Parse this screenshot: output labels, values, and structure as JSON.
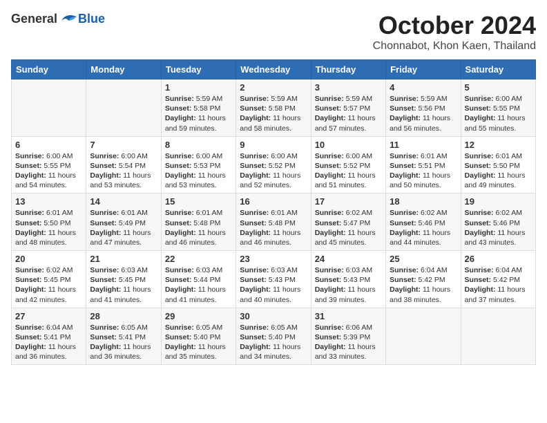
{
  "logo": {
    "general": "General",
    "blue": "Blue"
  },
  "title": "October 2024",
  "location": "Chonnabot, Khon Kaen, Thailand",
  "weekdays": [
    "Sunday",
    "Monday",
    "Tuesday",
    "Wednesday",
    "Thursday",
    "Friday",
    "Saturday"
  ],
  "weeks": [
    [
      {
        "day": "",
        "info": ""
      },
      {
        "day": "",
        "info": ""
      },
      {
        "day": "1",
        "info": "Sunrise: 5:59 AM\nSunset: 5:58 PM\nDaylight: 11 hours and 59 minutes."
      },
      {
        "day": "2",
        "info": "Sunrise: 5:59 AM\nSunset: 5:58 PM\nDaylight: 11 hours and 58 minutes."
      },
      {
        "day": "3",
        "info": "Sunrise: 5:59 AM\nSunset: 5:57 PM\nDaylight: 11 hours and 57 minutes."
      },
      {
        "day": "4",
        "info": "Sunrise: 5:59 AM\nSunset: 5:56 PM\nDaylight: 11 hours and 56 minutes."
      },
      {
        "day": "5",
        "info": "Sunrise: 6:00 AM\nSunset: 5:55 PM\nDaylight: 11 hours and 55 minutes."
      }
    ],
    [
      {
        "day": "6",
        "info": "Sunrise: 6:00 AM\nSunset: 5:55 PM\nDaylight: 11 hours and 54 minutes."
      },
      {
        "day": "7",
        "info": "Sunrise: 6:00 AM\nSunset: 5:54 PM\nDaylight: 11 hours and 53 minutes."
      },
      {
        "day": "8",
        "info": "Sunrise: 6:00 AM\nSunset: 5:53 PM\nDaylight: 11 hours and 53 minutes."
      },
      {
        "day": "9",
        "info": "Sunrise: 6:00 AM\nSunset: 5:52 PM\nDaylight: 11 hours and 52 minutes."
      },
      {
        "day": "10",
        "info": "Sunrise: 6:00 AM\nSunset: 5:52 PM\nDaylight: 11 hours and 51 minutes."
      },
      {
        "day": "11",
        "info": "Sunrise: 6:01 AM\nSunset: 5:51 PM\nDaylight: 11 hours and 50 minutes."
      },
      {
        "day": "12",
        "info": "Sunrise: 6:01 AM\nSunset: 5:50 PM\nDaylight: 11 hours and 49 minutes."
      }
    ],
    [
      {
        "day": "13",
        "info": "Sunrise: 6:01 AM\nSunset: 5:50 PM\nDaylight: 11 hours and 48 minutes."
      },
      {
        "day": "14",
        "info": "Sunrise: 6:01 AM\nSunset: 5:49 PM\nDaylight: 11 hours and 47 minutes."
      },
      {
        "day": "15",
        "info": "Sunrise: 6:01 AM\nSunset: 5:48 PM\nDaylight: 11 hours and 46 minutes."
      },
      {
        "day": "16",
        "info": "Sunrise: 6:01 AM\nSunset: 5:48 PM\nDaylight: 11 hours and 46 minutes."
      },
      {
        "day": "17",
        "info": "Sunrise: 6:02 AM\nSunset: 5:47 PM\nDaylight: 11 hours and 45 minutes."
      },
      {
        "day": "18",
        "info": "Sunrise: 6:02 AM\nSunset: 5:46 PM\nDaylight: 11 hours and 44 minutes."
      },
      {
        "day": "19",
        "info": "Sunrise: 6:02 AM\nSunset: 5:46 PM\nDaylight: 11 hours and 43 minutes."
      }
    ],
    [
      {
        "day": "20",
        "info": "Sunrise: 6:02 AM\nSunset: 5:45 PM\nDaylight: 11 hours and 42 minutes."
      },
      {
        "day": "21",
        "info": "Sunrise: 6:03 AM\nSunset: 5:45 PM\nDaylight: 11 hours and 41 minutes."
      },
      {
        "day": "22",
        "info": "Sunrise: 6:03 AM\nSunset: 5:44 PM\nDaylight: 11 hours and 41 minutes."
      },
      {
        "day": "23",
        "info": "Sunrise: 6:03 AM\nSunset: 5:43 PM\nDaylight: 11 hours and 40 minutes."
      },
      {
        "day": "24",
        "info": "Sunrise: 6:03 AM\nSunset: 5:43 PM\nDaylight: 11 hours and 39 minutes."
      },
      {
        "day": "25",
        "info": "Sunrise: 6:04 AM\nSunset: 5:42 PM\nDaylight: 11 hours and 38 minutes."
      },
      {
        "day": "26",
        "info": "Sunrise: 6:04 AM\nSunset: 5:42 PM\nDaylight: 11 hours and 37 minutes."
      }
    ],
    [
      {
        "day": "27",
        "info": "Sunrise: 6:04 AM\nSunset: 5:41 PM\nDaylight: 11 hours and 36 minutes."
      },
      {
        "day": "28",
        "info": "Sunrise: 6:05 AM\nSunset: 5:41 PM\nDaylight: 11 hours and 36 minutes."
      },
      {
        "day": "29",
        "info": "Sunrise: 6:05 AM\nSunset: 5:40 PM\nDaylight: 11 hours and 35 minutes."
      },
      {
        "day": "30",
        "info": "Sunrise: 6:05 AM\nSunset: 5:40 PM\nDaylight: 11 hours and 34 minutes."
      },
      {
        "day": "31",
        "info": "Sunrise: 6:06 AM\nSunset: 5:39 PM\nDaylight: 11 hours and 33 minutes."
      },
      {
        "day": "",
        "info": ""
      },
      {
        "day": "",
        "info": ""
      }
    ]
  ]
}
